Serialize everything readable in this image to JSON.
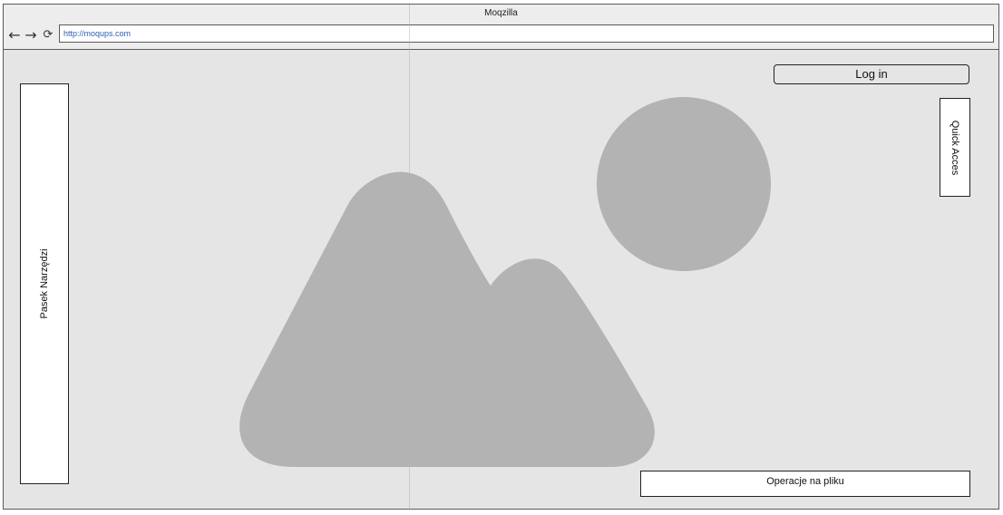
{
  "window": {
    "title": "Moqzilla"
  },
  "toolbar": {
    "back_icon": "arrow-left-icon",
    "forward_icon": "arrow-right-icon",
    "reload_icon": "reload-icon",
    "url": "http://moqups.com"
  },
  "sidebar": {
    "label": "Pasek Narzędzi"
  },
  "header": {
    "login_label": "Log in"
  },
  "quick_access": {
    "label": "Quick Acces"
  },
  "footer": {
    "file_ops_label": "Operacje na pliku"
  },
  "image_placeholder": {
    "icon": "image-placeholder-icon",
    "color": "#b3b3b3"
  }
}
